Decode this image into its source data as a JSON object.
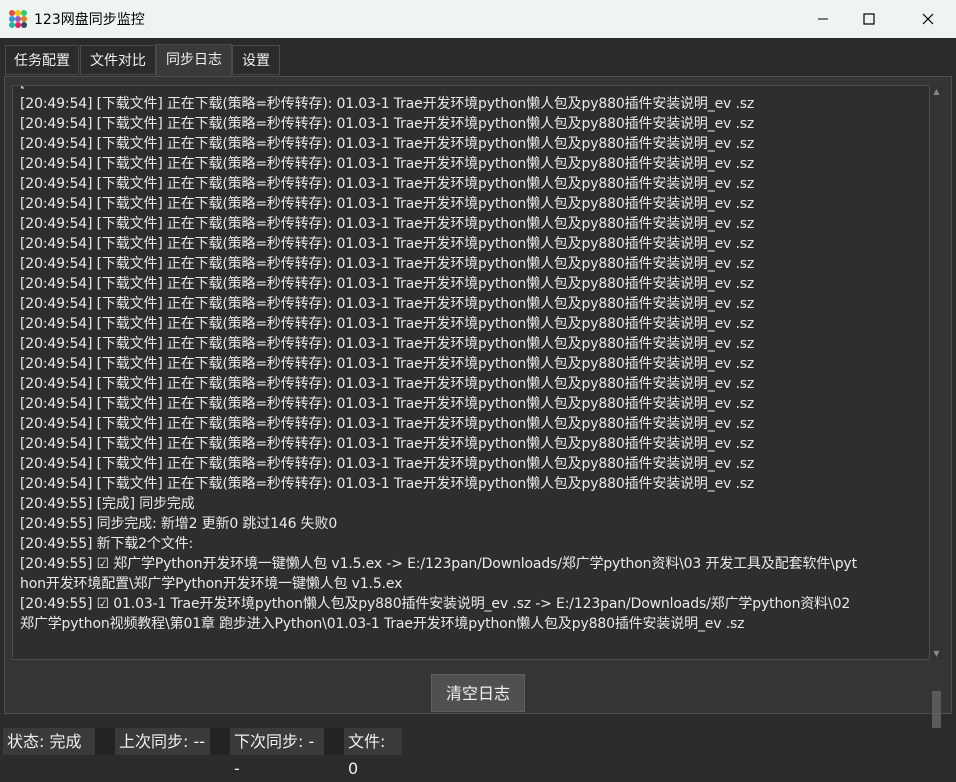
{
  "window": {
    "title": "123网盘同步监控",
    "app_icon": "colored-dots-icon",
    "controls": [
      "minimize-icon",
      "maximize-icon",
      "close-icon"
    ]
  },
  "tabs": [
    {
      "label": "任务配置",
      "active": false
    },
    {
      "label": "文件对比",
      "active": false
    },
    {
      "label": "同步日志",
      "active": true
    },
    {
      "label": "设置",
      "active": false
    }
  ],
  "log": {
    "partial_top": "[",
    "lines": [
      "[20:49:54] [下载文件] 正在下载(策略=秒传转存): 01.03-1 Trae开发环境python懒人包及py880插件安装说明_ev .sz",
      "[20:49:54] [下载文件] 正在下载(策略=秒传转存): 01.03-1 Trae开发环境python懒人包及py880插件安装说明_ev .sz",
      "[20:49:54] [下载文件] 正在下载(策略=秒传转存): 01.03-1 Trae开发环境python懒人包及py880插件安装说明_ev .sz",
      "[20:49:54] [下载文件] 正在下载(策略=秒传转存): 01.03-1 Trae开发环境python懒人包及py880插件安装说明_ev .sz",
      "[20:49:54] [下载文件] 正在下载(策略=秒传转存): 01.03-1 Trae开发环境python懒人包及py880插件安装说明_ev .sz",
      "[20:49:54] [下载文件] 正在下载(策略=秒传转存): 01.03-1 Trae开发环境python懒人包及py880插件安装说明_ev .sz",
      "[20:49:54] [下载文件] 正在下载(策略=秒传转存): 01.03-1 Trae开发环境python懒人包及py880插件安装说明_ev .sz",
      "[20:49:54] [下载文件] 正在下载(策略=秒传转存): 01.03-1 Trae开发环境python懒人包及py880插件安装说明_ev .sz",
      "[20:49:54] [下载文件] 正在下载(策略=秒传转存): 01.03-1 Trae开发环境python懒人包及py880插件安装说明_ev .sz",
      "[20:49:54] [下载文件] 正在下载(策略=秒传转存): 01.03-1 Trae开发环境python懒人包及py880插件安装说明_ev .sz",
      "[20:49:54] [下载文件] 正在下载(策略=秒传转存): 01.03-1 Trae开发环境python懒人包及py880插件安装说明_ev .sz",
      "[20:49:54] [下载文件] 正在下载(策略=秒传转存): 01.03-1 Trae开发环境python懒人包及py880插件安装说明_ev .sz",
      "[20:49:54] [下载文件] 正在下载(策略=秒传转存): 01.03-1 Trae开发环境python懒人包及py880插件安装说明_ev .sz",
      "[20:49:54] [下载文件] 正在下载(策略=秒传转存): 01.03-1 Trae开发环境python懒人包及py880插件安装说明_ev .sz",
      "[20:49:54] [下载文件] 正在下载(策略=秒传转存): 01.03-1 Trae开发环境python懒人包及py880插件安装说明_ev .sz",
      "[20:49:54] [下载文件] 正在下载(策略=秒传转存): 01.03-1 Trae开发环境python懒人包及py880插件安装说明_ev .sz",
      "[20:49:54] [下载文件] 正在下载(策略=秒传转存): 01.03-1 Trae开发环境python懒人包及py880插件安装说明_ev .sz",
      "[20:49:54] [下载文件] 正在下载(策略=秒传转存): 01.03-1 Trae开发环境python懒人包及py880插件安装说明_ev .sz",
      "[20:49:54] [下载文件] 正在下载(策略=秒传转存): 01.03-1 Trae开发环境python懒人包及py880插件安装说明_ev .sz",
      "[20:49:54] [下载文件] 正在下载(策略=秒传转存): 01.03-1 Trae开发环境python懒人包及py880插件安装说明_ev .sz",
      "[20:49:55] [完成] 同步完成",
      "[20:49:55] 同步完成: 新增2 更新0 跳过146 失败0",
      "[20:49:55]    新下载2个文件:",
      "[20:49:55]      ☑ 郑广学Python开发环境一键懒人包 v1.5.ex -> E:/123pan/Downloads/郑广学python资料\\03 开发工具及配套软件\\pyt",
      "hon开发环境配置\\郑广学Python开发环境一键懒人包 v1.5.ex",
      "[20:49:55]      ☑ 01.03-1 Trae开发环境python懒人包及py880插件安装说明_ev .sz -> E:/123pan/Downloads/郑广学python资料\\02",
      "郑广学python视频教程\\第01章 跑步进入Python\\01.03-1 Trae开发环境python懒人包及py880插件安装说明_ev .sz"
    ]
  },
  "clear_button": "清空日志",
  "status": {
    "state": "状态: 完成",
    "last_sync": "上次同步: --",
    "next_sync": "下次同步: --",
    "files": "文件: 0"
  },
  "colors": {
    "background": "#2b2b2b",
    "panel": "#353535",
    "log_bg": "#2e2e2e",
    "text": "#eaeaea",
    "titlebar": "#eef5f1"
  }
}
